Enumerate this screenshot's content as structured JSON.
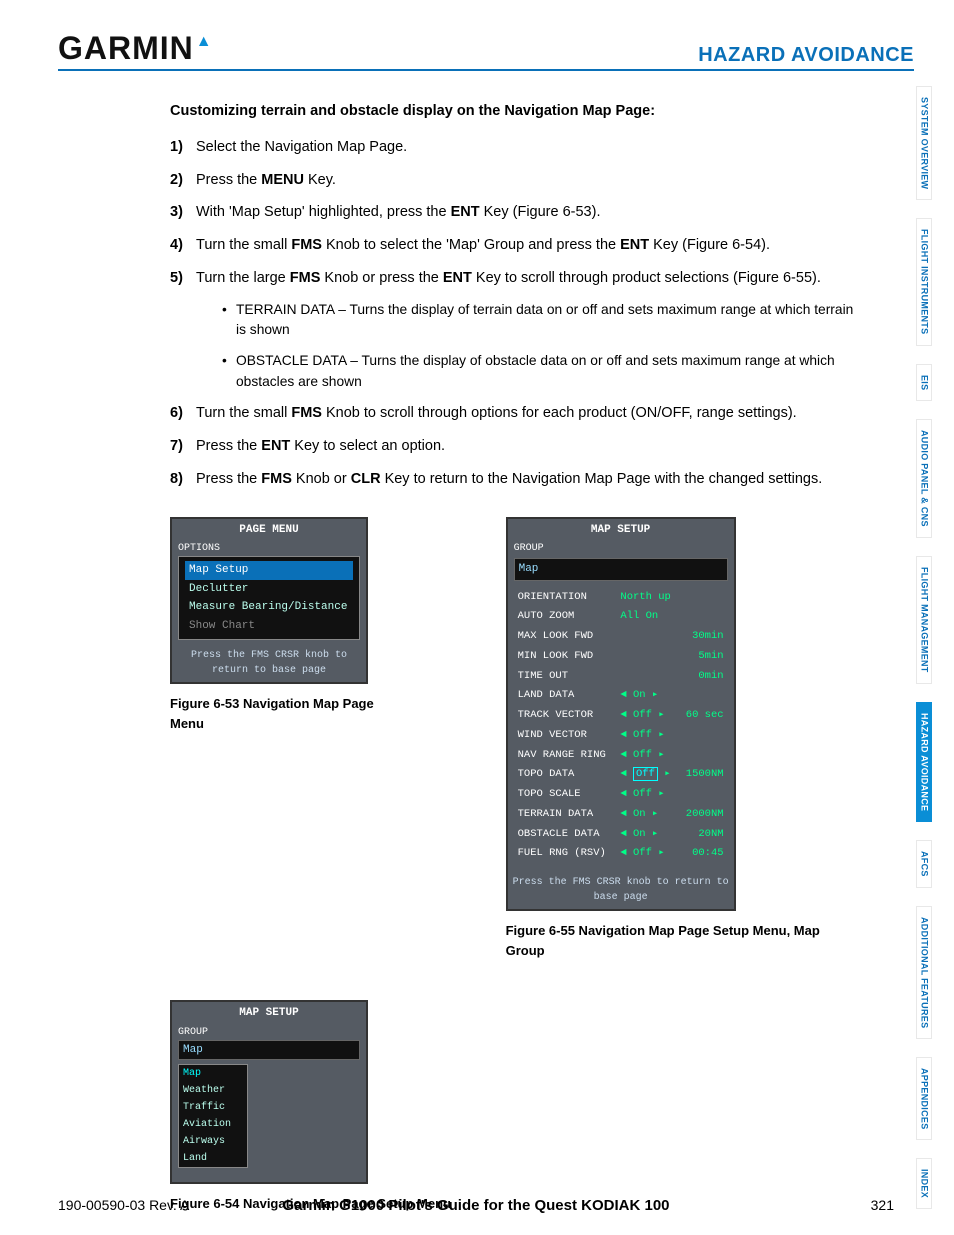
{
  "header": {
    "logo_text": "GARMIN",
    "section_title": "HAZARD AVOIDANCE"
  },
  "subheading": "Customizing terrain and obstacle display on the Navigation Map Page:",
  "steps": [
    {
      "n": "1)",
      "pre": "Select the Navigation Map Page.",
      "bold": "",
      "post": ""
    },
    {
      "n": "2)",
      "pre": "Press the ",
      "bold": "MENU",
      "post": " Key."
    },
    {
      "n": "3)",
      "pre": "With 'Map Setup' highlighted, press the ",
      "bold": "ENT",
      "post": " Key (Figure 6-53)."
    },
    {
      "n": "4)",
      "pre": "Turn the small ",
      "bold": "FMS",
      "mid": " Knob to select the 'Map' Group and press the ",
      "bold2": "ENT",
      "post": " Key (Figure 6-54)."
    },
    {
      "n": "5)",
      "pre": "Turn the large ",
      "bold": "FMS",
      "mid": " Knob or press the ",
      "bold2": "ENT",
      "post": " Key to scroll through product selections (Figure 6-55)."
    },
    {
      "n": "6)",
      "pre": "Turn the small ",
      "bold": "FMS",
      "post": " Knob to scroll through options for each product (ON/OFF, range settings)."
    },
    {
      "n": "7)",
      "pre": "Press the ",
      "bold": "ENT",
      "post": " Key to select an option."
    },
    {
      "n": "8)",
      "pre": "Press the ",
      "bold": "FMS",
      "mid": " Knob or ",
      "bold2": "CLR",
      "post": " Key to return to the Navigation Map Page with the changed settings."
    }
  ],
  "bullets": [
    "TERRAIN DATA – Turns the display of terrain data on or off and sets maximum range at which terrain is shown",
    "OBSTACLE DATA – Turns the display of obstacle data on or off and sets maximum range at which obstacles are shown"
  ],
  "fig53": {
    "title": "PAGE MENU",
    "group": "OPTIONS",
    "items": [
      "Map Setup",
      "Declutter",
      "Measure Bearing/Distance",
      "Show Chart"
    ],
    "selected": 0,
    "disabled": [
      3
    ],
    "hint": "Press the FMS CRSR knob to return to base page",
    "caption": "Figure 6-53  Navigation Map Page Menu"
  },
  "fig54": {
    "title": "MAP SETUP",
    "group_label": "GROUP",
    "group_value": "Map",
    "dropdown": [
      "Map",
      "Weather",
      "Traffic",
      "Aviation",
      "Airways",
      "Land"
    ],
    "caption": "Figure 6-54  Navigation Map Page Setup Menu"
  },
  "fig55": {
    "title": "MAP SETUP",
    "group_label": "GROUP",
    "group_value": "Map",
    "rows": [
      {
        "label": "ORIENTATION",
        "val": "North up",
        "extra": ""
      },
      {
        "label": "AUTO ZOOM",
        "val": "All On",
        "extra": ""
      },
      {
        "label": "  MAX LOOK FWD",
        "val": "",
        "extra": "30min"
      },
      {
        "label": "  MIN LOOK FWD",
        "val": "",
        "extra": "5min"
      },
      {
        "label": "  TIME OUT",
        "val": "",
        "extra": "0min"
      },
      {
        "label": "LAND DATA",
        "val": "◄ On  ▸",
        "extra": ""
      },
      {
        "label": "TRACK VECTOR",
        "val": "◄ Off ▸",
        "extra": "60 sec"
      },
      {
        "label": "WIND VECTOR",
        "val": "◄ Off ▸",
        "extra": ""
      },
      {
        "label": "NAV RANGE RING",
        "val": "◄ Off ▸",
        "extra": ""
      },
      {
        "label": "TOPO DATA",
        "val": "◄ Off ▸",
        "extra": "1500NM",
        "boxed": true
      },
      {
        "label": "TOPO SCALE",
        "val": "◄ Off ▸",
        "extra": ""
      },
      {
        "label": "TERRAIN DATA",
        "val": "◄ On  ▸",
        "extra": "2000NM"
      },
      {
        "label": "OBSTACLE DATA",
        "val": "◄ On  ▸",
        "extra": "20NM"
      },
      {
        "label": "FUEL RNG (RSV)",
        "val": "◄ Off ▸",
        "extra": "00:45"
      }
    ],
    "hint": "Press the FMS CRSR knob to return to base page",
    "caption": "Figure 6-55  Navigation Map Page Setup Menu, Map Group"
  },
  "footer": {
    "left": "190-00590-03  Rev. A",
    "center": "Garmin G1000 Pilot's Guide for the Quest KODIAK 100",
    "right": "321"
  },
  "tabs": [
    {
      "l1": "SYSTEM",
      "l2": "OVERVIEW",
      "active": false
    },
    {
      "l1": "FLIGHT",
      "l2": "INSTRUMENTS",
      "active": false
    },
    {
      "l1": "EIS",
      "l2": "",
      "active": false
    },
    {
      "l1": "AUDIO PANEL",
      "l2": "& CNS",
      "active": false
    },
    {
      "l1": "FLIGHT",
      "l2": "MANAGEMENT",
      "active": false
    },
    {
      "l1": "HAZARD",
      "l2": "AVOIDANCE",
      "active": true
    },
    {
      "l1": "AFCS",
      "l2": "",
      "active": false
    },
    {
      "l1": "ADDITIONAL",
      "l2": "FEATURES",
      "active": false
    },
    {
      "l1": "APPENDICES",
      "l2": "",
      "active": false
    },
    {
      "l1": "INDEX",
      "l2": "",
      "active": false
    }
  ]
}
